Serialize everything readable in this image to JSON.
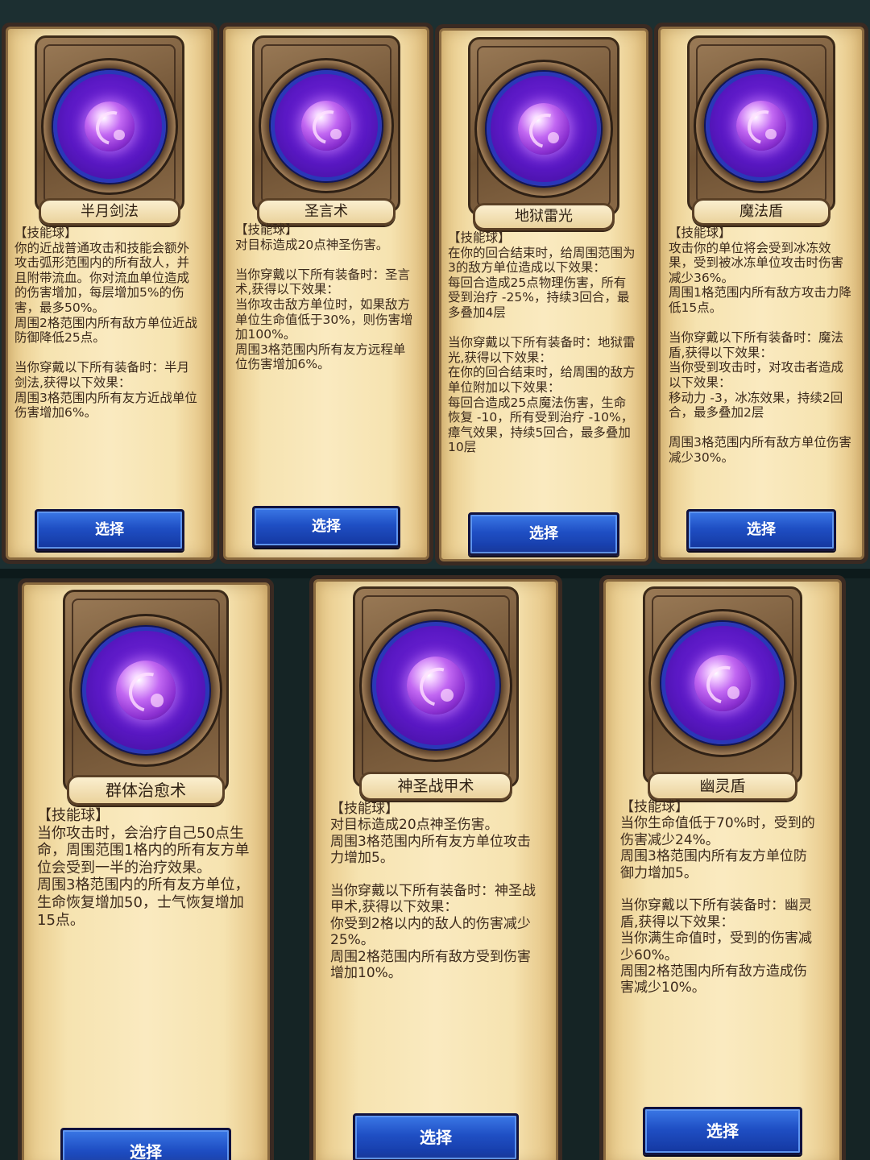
{
  "cards": [
    {
      "name": "半月剑法",
      "description": "【技能球】\n你的近战普通攻击和技能会额外攻击弧形范围内的所有敌人，并且附带流血。你对流血单位造成的伤害增加，每层增加5%的伤害，最多50%。\n周围2格范围内所有敌方单位近战防御降低25点。\n\n当你穿戴以下所有装备时：半月剑法,获得以下效果：\n周围3格范围内所有友方近战单位伤害增加6%。",
      "button": "选择"
    },
    {
      "name": "圣言术",
      "description": "【技能球】\n对目标造成20点神圣伤害。\n\n当你穿戴以下所有装备时：圣言术,获得以下效果：\n当你攻击敌方单位时，如果敌方单位生命值低于30%，则伤害增加100%。\n周围3格范围内所有友方远程单位伤害增加6%。",
      "button": "选择"
    },
    {
      "name": "地狱雷光",
      "description": "【技能球】\n在你的回合结束时，给周围范围为3的敌方单位造成以下效果：\n每回合造成25点物理伤害，所有受到治疗 -25%，持续3回合，最多叠加4层\n\n当你穿戴以下所有装备时：地狱雷光,获得以下效果：\n在你的回合结束时，给周围的敌方单位附加以下效果：\n每回合造成25点魔法伤害，生命恢复 -10，所有受到治疗 -10%，瘴气效果，持续5回合，最多叠加10层",
      "button": "选择"
    },
    {
      "name": "魔法盾",
      "description": "【技能球】\n攻击你的单位将会受到冰冻效果，受到被冰冻单位攻击时伤害减少36%。\n周围1格范围内所有敌方攻击力降低15点。\n\n当你穿戴以下所有装备时：魔法盾,获得以下效果：\n当你受到攻击时，对攻击者造成以下效果：\n移动力 -3，冰冻效果，持续2回合，最多叠加2层\n\n周围3格范围内所有敌方单位伤害减少30%。",
      "button": "选择"
    },
    {
      "name": "群体治愈术",
      "description": "【技能球】\n当你攻击时，会治疗自己50点生命，周围范围1格内的所有友方单位会受到一半的治疗效果。\n周围3格范围内的所有友方单位，生命恢复增加50，士气恢复增加15点。",
      "button": "选择"
    },
    {
      "name": "神圣战甲术",
      "description": "【技能球】\n对目标造成20点神圣伤害。\n周围3格范围内所有友方单位攻击力增加5。\n\n当你穿戴以下所有装备时：神圣战甲术,获得以下效果：\n你受到2格以内的敌人的伤害减少25%。\n周围2格范围内所有敌方受到伤害增加10%。",
      "button": "选择"
    },
    {
      "name": "幽灵盾",
      "description": "【技能球】\n当你生命值低于70%时，受到的伤害减少24%。\n周围3格范围内所有友方单位防御力增加5。\n\n当你穿戴以下所有装备时：幽灵盾,获得以下效果：\n当你满生命值时，受到的伤害减少60%。\n周围2格范围内所有敌方造成伤害减少10%。",
      "button": "选择"
    }
  ]
}
